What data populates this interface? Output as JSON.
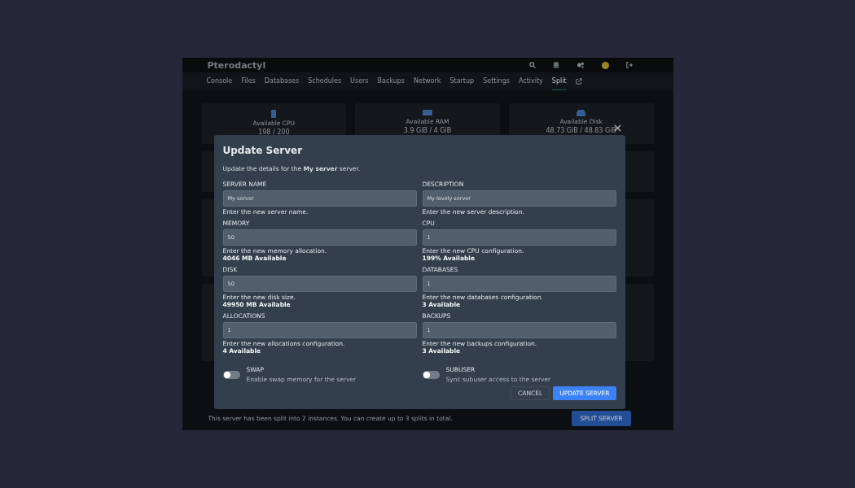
{
  "app": {
    "brand": "Pterodactyl",
    "tabs": [
      {
        "label": "Console",
        "selected": false
      },
      {
        "label": "Files",
        "selected": false
      },
      {
        "label": "Databases",
        "selected": false
      },
      {
        "label": "Schedules",
        "selected": false
      },
      {
        "label": "Users",
        "selected": false
      },
      {
        "label": "Backups",
        "selected": false
      },
      {
        "label": "Network",
        "selected": false
      },
      {
        "label": "Startup",
        "selected": false
      },
      {
        "label": "Settings",
        "selected": false
      },
      {
        "label": "Activity",
        "selected": false
      },
      {
        "label": "Split",
        "selected": true
      }
    ],
    "stats": [
      {
        "kind": "cpu",
        "label": "Available CPU",
        "value": "198 / 200"
      },
      {
        "kind": "ram",
        "label": "Available RAM",
        "value": "3.9 GiB / 4 GiB"
      },
      {
        "kind": "disk",
        "label": "Available Disk",
        "value": "48.73 GiB / 48.83 GiB"
      }
    ],
    "split_note": "This server has been split into 2 instances. You can create up to 3 splits in total.",
    "split_button": "SPLIT SERVER"
  },
  "modal": {
    "title": "Update Server",
    "description": "Update the details for the **My server** server.",
    "fields": [
      {
        "label": "SERVER NAME",
        "value": "My server",
        "help": "Enter the new server name."
      },
      {
        "label": "DESCRIPTION",
        "value": "My lovely server",
        "help": "Enter the new server description."
      },
      {
        "label": "MEMORY",
        "value": "50",
        "help": "Enter the new memory allocation.",
        "available": "4046 MB Available"
      },
      {
        "label": "CPU",
        "value": "1",
        "help": "Enter the new CPU configuration.",
        "available": "199% Available"
      },
      {
        "label": "DISK",
        "value": "50",
        "help": "Enter the new disk size.",
        "available": "49950 MB Available"
      },
      {
        "label": "DATABASES",
        "value": "1",
        "help": "Enter the new databases configuration.",
        "available": "3 Available"
      },
      {
        "label": "ALLOCATIONS",
        "value": "1",
        "help": "Enter the new allocations configuration.",
        "available": "4 Available"
      },
      {
        "label": "BACKUPS",
        "value": "1",
        "help": "Enter the new backups configuration.",
        "available": "3 Available"
      }
    ],
    "toggles": [
      {
        "label": "SWAP",
        "description": "Enable swap memory for the server",
        "on": false
      },
      {
        "label": "SUBUSER",
        "description": "Sync subuser access to the server",
        "on": false
      }
    ],
    "cancel": "CANCEL",
    "submit": "UPDATE SERVER"
  }
}
